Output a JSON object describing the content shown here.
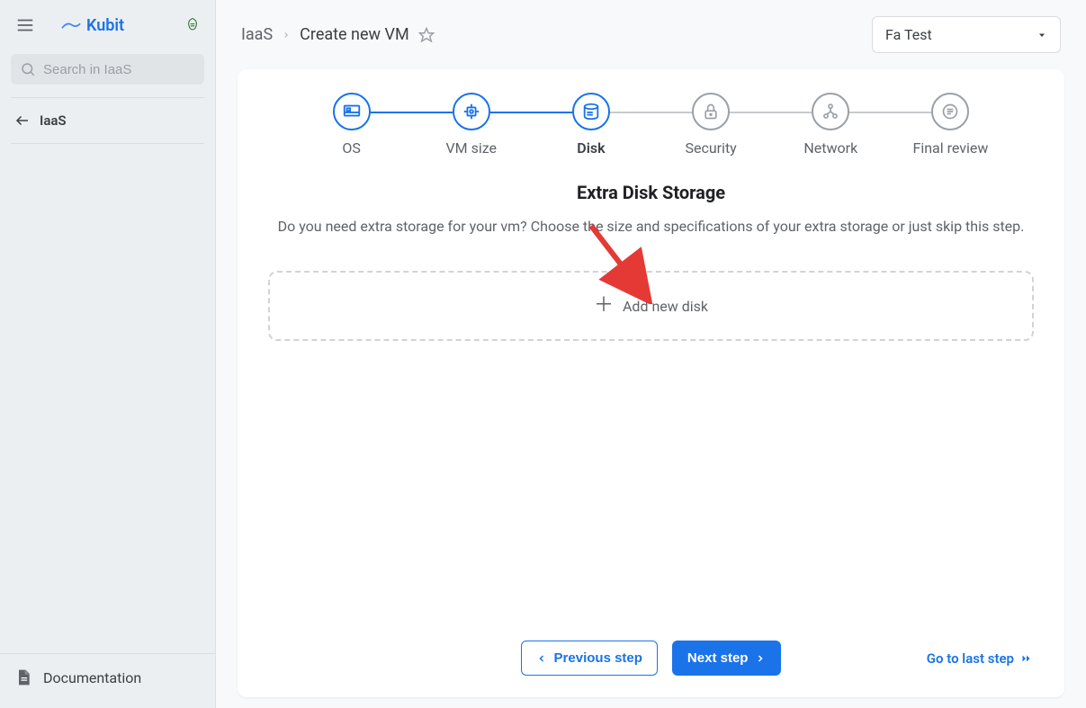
{
  "brand": {
    "name": "Kubit"
  },
  "sidebar": {
    "search_placeholder": "Search in IaaS",
    "nav_back_label": "IaaS",
    "doc_label": "Documentation"
  },
  "topbar": {
    "crumb_root": "IaaS",
    "crumb_current": "Create new VM",
    "account_label": "Fa Test"
  },
  "stepper": {
    "steps": [
      {
        "label": "OS",
        "state": "done"
      },
      {
        "label": "VM size",
        "state": "done"
      },
      {
        "label": "Disk",
        "state": "active"
      },
      {
        "label": "Security",
        "state": "pending"
      },
      {
        "label": "Network",
        "state": "pending"
      },
      {
        "label": "Final review",
        "state": "pending"
      }
    ]
  },
  "content": {
    "title": "Extra Disk Storage",
    "description": "Do you need extra storage for your vm? Choose the size and specifications of your extra storage or just skip this step.",
    "add_disk_label": "Add new disk"
  },
  "footer": {
    "prev_label": "Previous step",
    "next_label": "Next step",
    "skip_label": "Go to last step"
  }
}
